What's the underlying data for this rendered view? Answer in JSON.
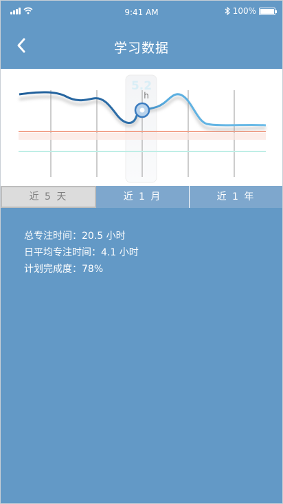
{
  "status_bar": {
    "time": "9:41 AM",
    "battery": "100%"
  },
  "nav": {
    "title": "学习数据",
    "back_icon": "chevron-left-icon"
  },
  "chart": {
    "tooltip_value": "5.2",
    "tooltip_unit": "h",
    "line_color": "#2f6fa9",
    "line_color_light": "#5aaee0",
    "upper_ref_color": "#f2a38c",
    "lower_ref_color": "#bfeee6",
    "selected_index": 3
  },
  "tabs": [
    {
      "label": "近 5 天",
      "active": true
    },
    {
      "label": "近 1 月",
      "active": false
    },
    {
      "label": "近 1 年",
      "active": false
    }
  ],
  "stats": {
    "total_focus": "总专注时间：20.5 小时",
    "daily_avg": "日平均专注时间：4.1 小时",
    "plan_completion": "计划完成度：78%"
  },
  "colors": {
    "background": "#6399c6",
    "panel": "#ffffff",
    "accent": "#2f6fa9"
  }
}
